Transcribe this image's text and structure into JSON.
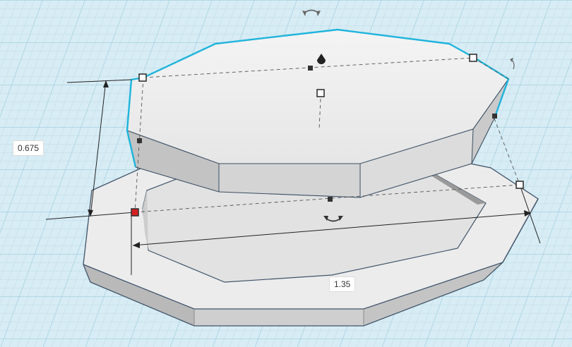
{
  "dimensions": {
    "height_value": "0.675",
    "width_value": "1.35"
  },
  "colors": {
    "workplane": "#d7ecf4",
    "grid_minor": "#bcdcea",
    "grid_major": "#9ccbe0",
    "selection_outline": "#1fb4dc",
    "active_handle": "#d42020"
  },
  "icons": [
    "rotate-arrow-icon",
    "rotate-arrow-icon",
    "rotate-arrow-icon",
    "lift-cone-icon"
  ]
}
